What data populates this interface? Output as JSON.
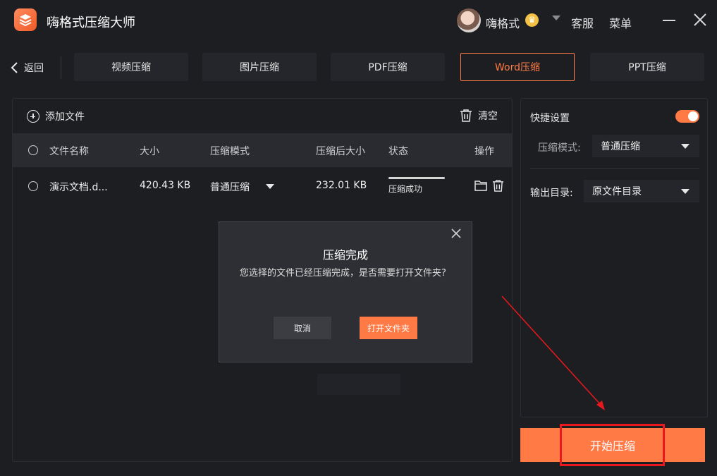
{
  "app": {
    "title": "嗨格式压缩大师",
    "username": "嗨格式",
    "vip_icon": "crown-badge-icon",
    "service": "客服",
    "menu": "菜单",
    "accent_color": "#ff7a45"
  },
  "nav": {
    "back": "返回",
    "tabs": [
      {
        "label": "视频压缩",
        "active": false
      },
      {
        "label": "图片压缩",
        "active": false
      },
      {
        "label": "PDF压缩",
        "active": false
      },
      {
        "label": "Word压缩",
        "active": true
      },
      {
        "label": "PPT压缩",
        "active": false
      }
    ]
  },
  "filelist": {
    "add_file": "添加文件",
    "clear": "清空",
    "columns": [
      "文件名称",
      "大小",
      "压缩模式",
      "压缩后大小",
      "状态",
      "操作"
    ],
    "rows": [
      {
        "name": "演示文档.d...",
        "size": "420.43 KB",
        "mode": "普通压缩",
        "compressed_size": "232.01 KB",
        "status": "压缩成功",
        "progress": 1.0
      }
    ]
  },
  "dialog": {
    "title": "压缩完成",
    "message": "您选择的文件已经压缩完成，是否需要打开文件夹?",
    "cancel": "取消",
    "open_folder": "打开文件夹"
  },
  "settings": {
    "quick_settings": "快捷设置",
    "quick_enabled": true,
    "mode_label": "压缩模式:",
    "mode_value": "普通压缩",
    "output_label": "输出目录:",
    "output_value": "原文件目录"
  },
  "start_button": "开始压缩"
}
